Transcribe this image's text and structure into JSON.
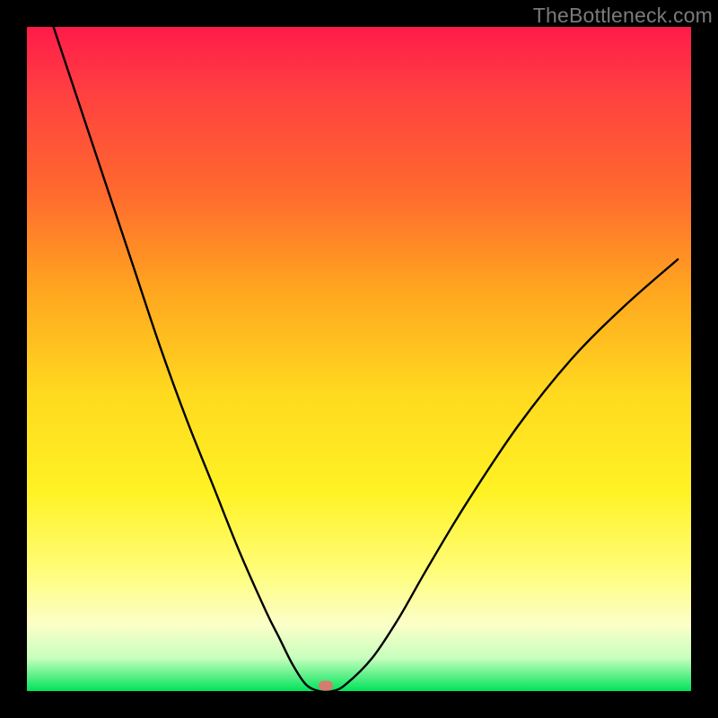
{
  "watermark": "TheBottleneck.com",
  "chart_data": {
    "type": "line",
    "title": "",
    "xlabel": "",
    "ylabel": "",
    "xlim": [
      0,
      100
    ],
    "ylim": [
      0,
      100
    ],
    "series": [
      {
        "name": "bottleneck-curve",
        "x": [
          4,
          8,
          12,
          16,
          20,
          24,
          28,
          32,
          36,
          38,
          40,
          42,
          44,
          46,
          48,
          52,
          56,
          60,
          66,
          74,
          82,
          90,
          98
        ],
        "y": [
          100,
          88,
          76,
          64,
          52,
          41,
          31,
          21,
          12,
          8,
          4,
          1,
          0,
          0,
          1,
          5,
          11,
          18,
          28,
          40,
          50,
          58,
          65
        ]
      }
    ],
    "annotations": [
      {
        "name": "min-marker",
        "x": 45,
        "y": 0.8
      }
    ],
    "background_gradient": [
      "#ff1b4b",
      "#ff6a2e",
      "#ffd91f",
      "#fffd7a",
      "#00e35a"
    ]
  }
}
